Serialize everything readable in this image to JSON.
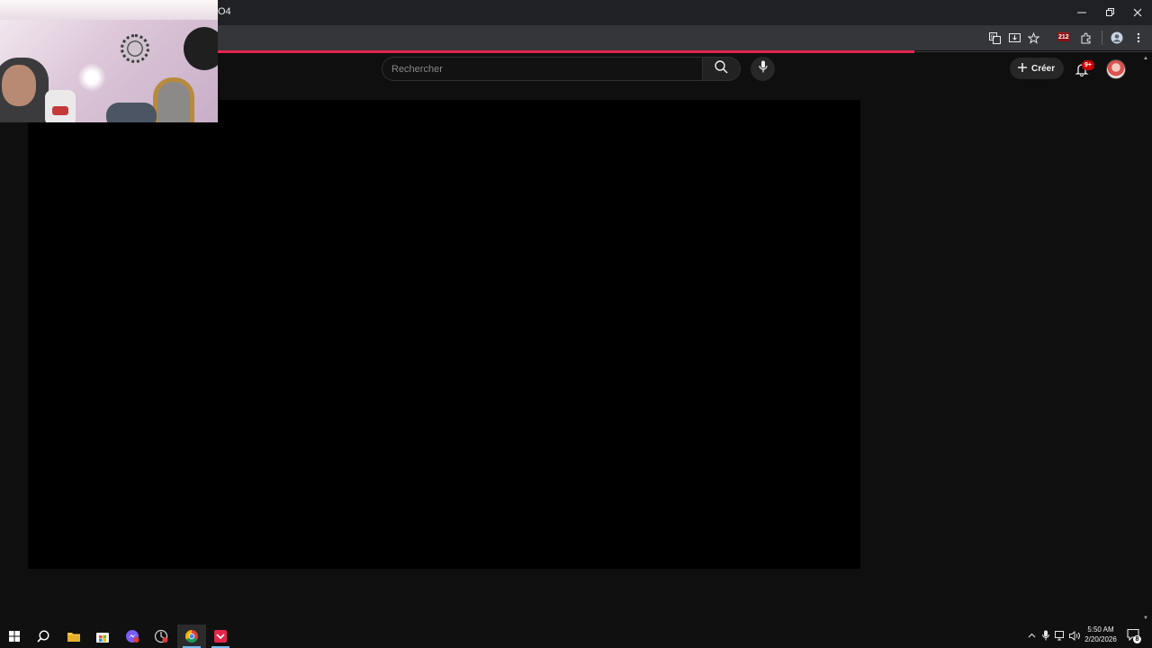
{
  "browser": {
    "url_fragment": "O4",
    "window_controls": {
      "minimize_icon": "minimize-icon",
      "restore_icon": "restore-icon",
      "close_icon": "close-icon"
    },
    "extension_badge": "212",
    "loading_color": "#e1264e"
  },
  "youtube": {
    "search_placeholder": "Rechercher",
    "create_label": "Créer",
    "notifications_badge": "9+",
    "accent": "#cc0000"
  },
  "taskbar": {
    "clock_time": "5:50 AM",
    "clock_date": "2/20/2026",
    "action_center_count": "8",
    "apps": [
      "start-icon",
      "search-icon",
      "file-explorer-icon",
      "store-icon",
      "messenger-icon",
      "app-icon",
      "chrome-icon",
      "app-icon"
    ]
  }
}
